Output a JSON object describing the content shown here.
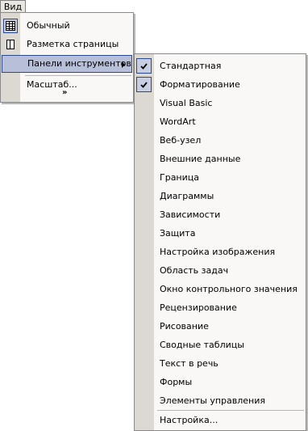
{
  "menubar": {
    "view_label": "Вид"
  },
  "view_menu": {
    "items": [
      {
        "label": "Обычный",
        "icon": "normal-view-icon"
      },
      {
        "label": "Разметка страницы",
        "icon": "page-layout-icon"
      },
      {
        "label": "Панели инструментов"
      },
      {
        "label": "Масштаб..."
      }
    ],
    "expand_glyph": "»"
  },
  "toolbars_menu": {
    "items": [
      {
        "label": "Стандартная",
        "checked": true
      },
      {
        "label": "Форматирование",
        "checked": true
      },
      {
        "label": "Visual Basic"
      },
      {
        "label": "WordArt"
      },
      {
        "label": "Веб-узел"
      },
      {
        "label": "Внешние данные"
      },
      {
        "label": "Граница"
      },
      {
        "label": "Диаграммы"
      },
      {
        "label": "Зависимости"
      },
      {
        "label": "Защита"
      },
      {
        "label": "Настройка изображения"
      },
      {
        "label": "Область задач"
      },
      {
        "label": "Окно контрольного значения"
      },
      {
        "label": "Рецензирование"
      },
      {
        "label": "Рисование"
      },
      {
        "label": "Сводные таблицы"
      },
      {
        "label": "Текст в речь"
      },
      {
        "label": "Формы"
      },
      {
        "label": "Элементы управления"
      }
    ],
    "customize_label": "Настройка..."
  },
  "colors": {
    "highlight": "#b7bfd9",
    "highlight_border": "#2f4a8c",
    "icon_strip": "#dcd9d2"
  }
}
